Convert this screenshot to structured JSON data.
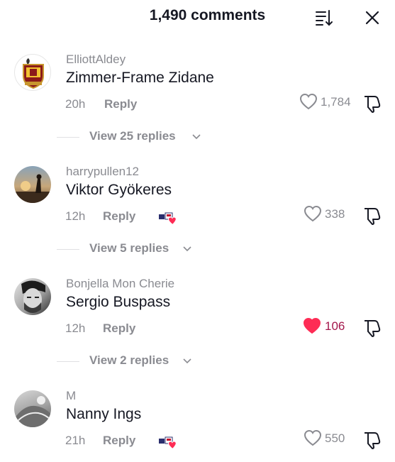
{
  "header": {
    "title": "1,490 comments"
  },
  "comments": [
    {
      "username": "ElliottAldey",
      "text": "Zimmer-Frame Zidane",
      "time": "20h",
      "reply_label": "Reply",
      "likes": "1,784",
      "liked": false,
      "creator_liked": false,
      "view_replies": "View 25 replies"
    },
    {
      "username": "harrypullen12",
      "text": "Viktor Gyökeres",
      "time": "12h",
      "reply_label": "Reply",
      "likes": "338",
      "liked": false,
      "creator_liked": true,
      "view_replies": "View 5 replies"
    },
    {
      "username": "Bonjella Mon Cherie",
      "text": "Sergio Buspass",
      "time": "12h",
      "reply_label": "Reply",
      "likes": "106",
      "liked": true,
      "creator_liked": false,
      "view_replies": "View 2 replies"
    },
    {
      "username": "M",
      "text": "Nanny Ings",
      "time": "21h",
      "reply_label": "Reply",
      "likes": "550",
      "liked": false,
      "creator_liked": true
    }
  ],
  "icons": {
    "sort": "sort-icon",
    "close": "close-icon",
    "like": "heart-icon",
    "dislike": "dislike-icon",
    "creator_like": "creator-liked-badge",
    "chevron": "chevron-down-icon"
  },
  "colors": {
    "liked_heart": "#fe2c55",
    "liked_count": "#a3174b",
    "muted": "#8a8b91",
    "text": "#161823"
  }
}
